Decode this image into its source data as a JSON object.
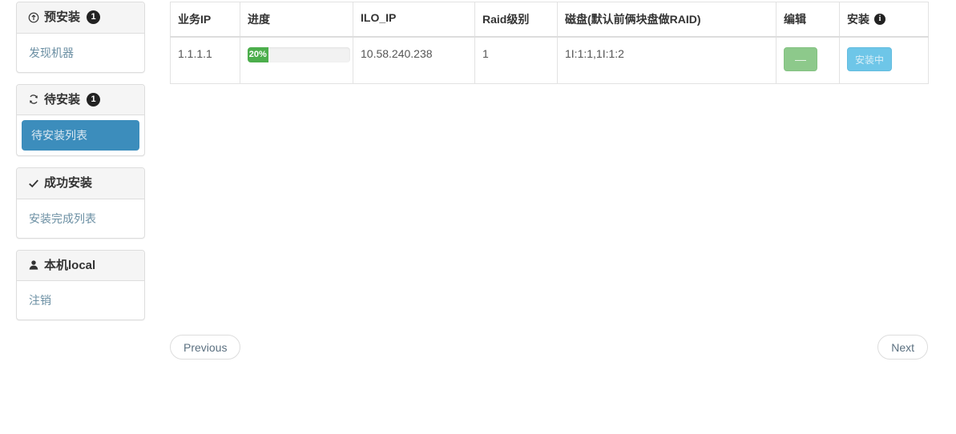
{
  "sidebar": {
    "sections": [
      {
        "icon": "circle-arrow-up-icon",
        "icon_glyph": "⊕",
        "title": "预安装",
        "badge": "1",
        "links": [
          {
            "label": "发现机器",
            "active": false
          }
        ]
      },
      {
        "icon": "refresh-icon",
        "icon_glyph": "↻",
        "title": "待安装",
        "badge": "1",
        "links": [
          {
            "label": "待安装列表",
            "active": true
          }
        ]
      },
      {
        "icon": "check-icon",
        "icon_glyph": "✔",
        "title": "成功安装",
        "badge": "",
        "links": [
          {
            "label": "安装完成列表",
            "active": false
          }
        ]
      },
      {
        "icon": "user-icon",
        "icon_glyph": "👤",
        "title": "本机local",
        "badge": "",
        "links": [
          {
            "label": "注销",
            "active": false
          }
        ]
      }
    ]
  },
  "table": {
    "headers": [
      {
        "label": "业务IP",
        "icon": ""
      },
      {
        "label": "进度",
        "icon": ""
      },
      {
        "label": "ILO_IP",
        "icon": ""
      },
      {
        "label": "Raid级别",
        "icon": ""
      },
      {
        "label": "磁盘(默认前俩块盘做RAID)",
        "icon": ""
      },
      {
        "label": "编辑",
        "icon": ""
      },
      {
        "label": "安装",
        "icon": "info-icon"
      }
    ],
    "rows": [
      {
        "service_ip": "1.1.1.1",
        "progress_label": "20%",
        "progress_percent": 20,
        "ilo_ip": "10.58.240.238",
        "raid_level": "1",
        "disks": "1I:1:1,1I:1:2",
        "edit_label": "—",
        "install_label": "安装中"
      }
    ]
  },
  "pager": {
    "previous_label": "Previous",
    "next_label": "Next"
  },
  "colors": {
    "active_nav": "#3c8dbc",
    "progress_fill": "#4cae4c",
    "edit_button": "#8dc98b",
    "install_button": "#6ec6e8",
    "badge": "#222222",
    "link_text": "#6b8fa3"
  }
}
